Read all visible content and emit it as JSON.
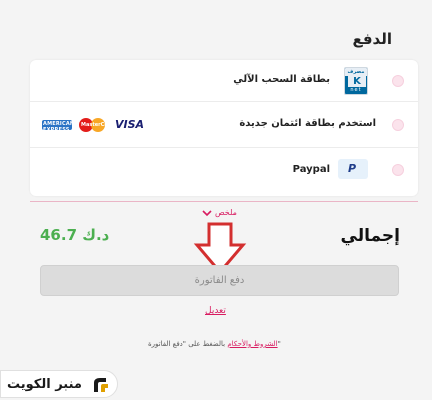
{
  "payment": {
    "title": "الدفع",
    "methods": [
      {
        "label": "بطاقة السحب الآلي",
        "logo": "knet-logo",
        "logo_top": "مصرف",
        "logo_letter": "K",
        "logo_bottom": "net"
      },
      {
        "label": "استخدم بطاقة ائتمان جديدة",
        "logos": [
          "amex-logo",
          "mastercard-logo",
          "visa-logo"
        ],
        "amex_text": "AMERICAN EXPRESS",
        "mc_text": "MasterCard",
        "visa_text": "VISA"
      },
      {
        "label": "Paypal",
        "logo": "paypal-logo",
        "logo_text": "P"
      }
    ]
  },
  "summary": {
    "link_label": "ملخص"
  },
  "total": {
    "label": "إجمالي",
    "value": "46.7 د.ك"
  },
  "pay_button": {
    "label": "دفع الفاتورة"
  },
  "edit_link": {
    "label": "تعديل"
  },
  "terms": {
    "prefix": "بالضغط على \"دفع الفاتورة\"",
    "link": "الشروط والأحكام"
  },
  "watermark": {
    "text": "منبر الكويت"
  },
  "colors": {
    "accent": "#d81b60",
    "total": "#4caf50",
    "arrow": "#d32f2f"
  }
}
